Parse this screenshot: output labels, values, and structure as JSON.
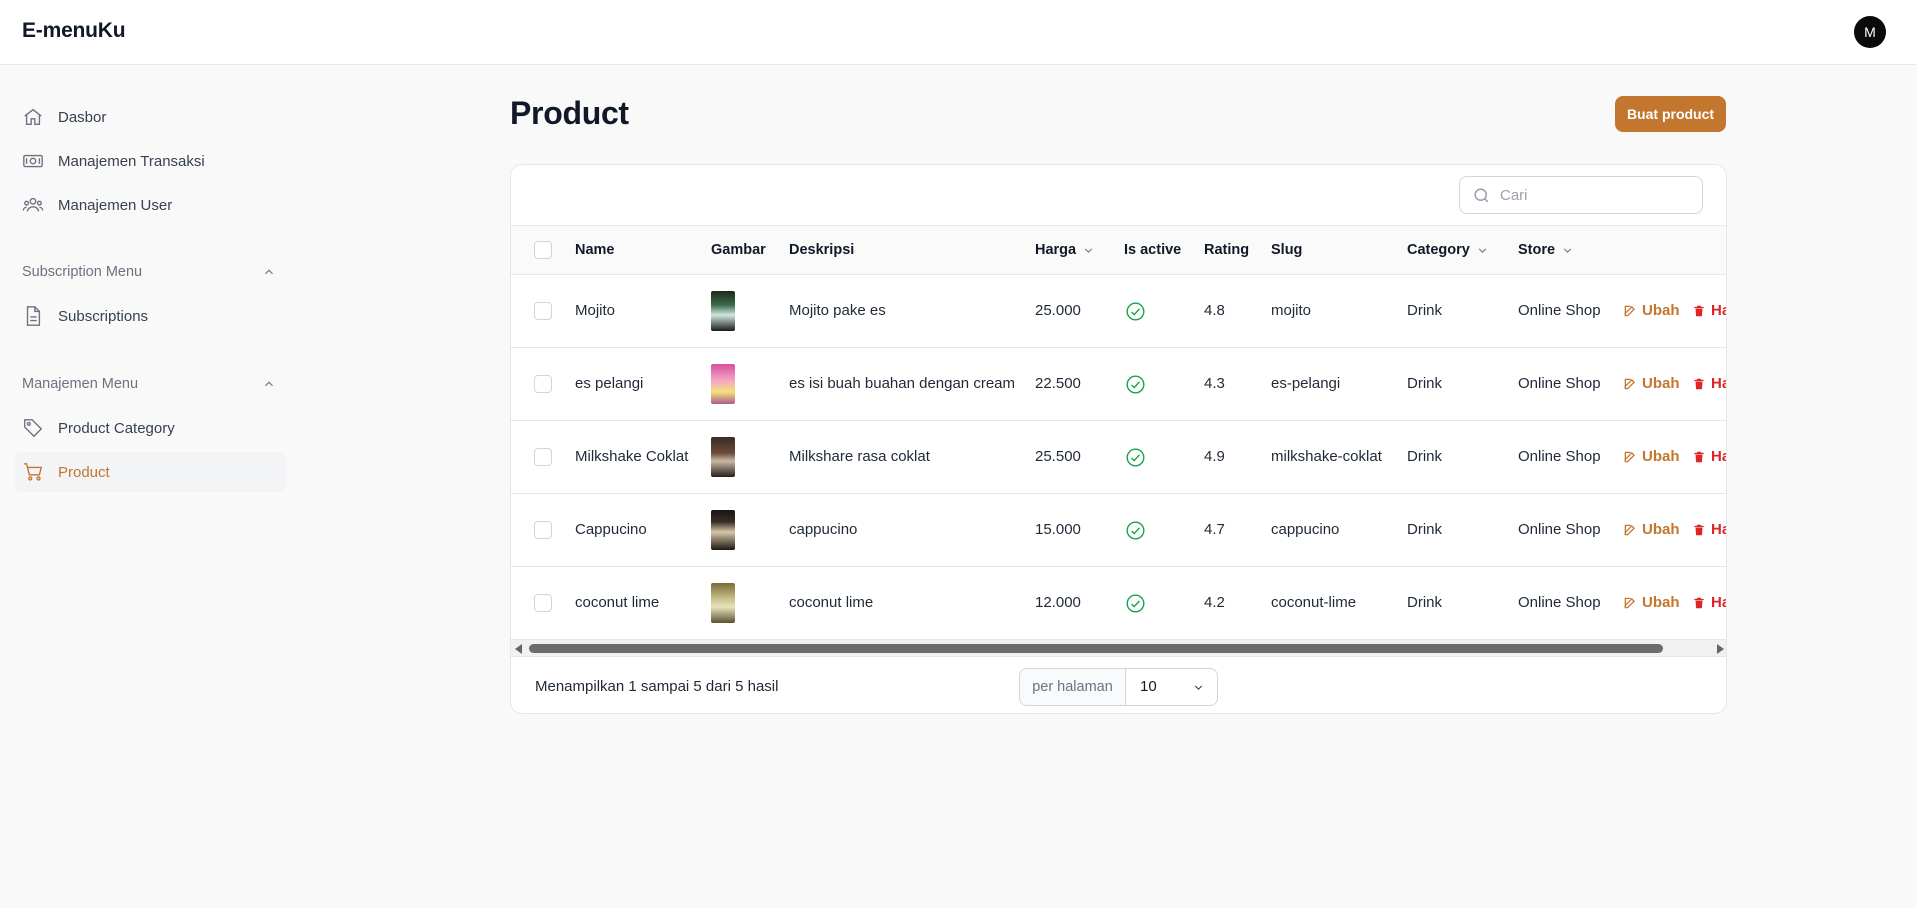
{
  "app": {
    "brand": "E-menuKu",
    "avatar_initial": "M"
  },
  "sidebar": {
    "items": [
      {
        "label": "Dasbor",
        "icon": "home-icon"
      },
      {
        "label": "Manajemen Transaksi",
        "icon": "cash-icon"
      },
      {
        "label": "Manajemen User",
        "icon": "users-icon"
      }
    ],
    "groups": [
      {
        "title": "Subscription Menu",
        "items": [
          {
            "label": "Subscriptions",
            "icon": "document-icon"
          }
        ]
      },
      {
        "title": "Manajemen Menu",
        "items": [
          {
            "label": "Product Category",
            "icon": "tag-icon"
          },
          {
            "label": "Product",
            "icon": "cart-icon",
            "active": true
          }
        ]
      }
    ]
  },
  "page": {
    "title": "Product",
    "create_label": "Buat product"
  },
  "search": {
    "placeholder": "Cari",
    "value": ""
  },
  "table": {
    "headers": {
      "name": "Name",
      "gambar": "Gambar",
      "deskripsi": "Deskripsi",
      "harga": "Harga",
      "is_active": "Is active",
      "rating": "Rating",
      "slug": "Slug",
      "category": "Category",
      "store": "Store"
    },
    "rows": [
      {
        "name": "Mojito",
        "deskripsi": "Mojito pake es",
        "harga": "25.000",
        "rating": "4.8",
        "slug": "mojito",
        "category": "Drink",
        "store": "Online Shop",
        "edit": "Ubah",
        "delete": "Ha"
      },
      {
        "name": "es pelangi",
        "deskripsi": "es isi buah buahan dengan cream",
        "harga": "22.500",
        "rating": "4.3",
        "slug": "es-pelangi",
        "category": "Drink",
        "store": "Online Shop",
        "edit": "Ubah",
        "delete": "Ha"
      },
      {
        "name": "Milkshake Coklat",
        "deskripsi": "Milkshare rasa coklat",
        "harga": "25.500",
        "rating": "4.9",
        "slug": "milkshake-coklat",
        "category": "Drink",
        "store": "Online Shop",
        "edit": "Ubah",
        "delete": "Ha"
      },
      {
        "name": "Cappucino",
        "deskripsi": "cappucino",
        "harga": "15.000",
        "rating": "4.7",
        "slug": "cappucino",
        "category": "Drink",
        "store": "Online Shop",
        "edit": "Ubah",
        "delete": "Ha"
      },
      {
        "name": "coconut lime",
        "deskripsi": "coconut lime",
        "harga": "12.000",
        "rating": "4.2",
        "slug": "coconut-lime",
        "category": "Drink",
        "store": "Online Shop",
        "edit": "Ubah",
        "delete": "Ha"
      }
    ]
  },
  "footer": {
    "summary": "Menampilkan 1 sampai 5 dari 5 hasil",
    "per_page_label": "per halaman",
    "per_page_value": "10"
  },
  "colors": {
    "accent": "#c2762e",
    "danger": "#dc2626",
    "success": "#16a34a"
  }
}
